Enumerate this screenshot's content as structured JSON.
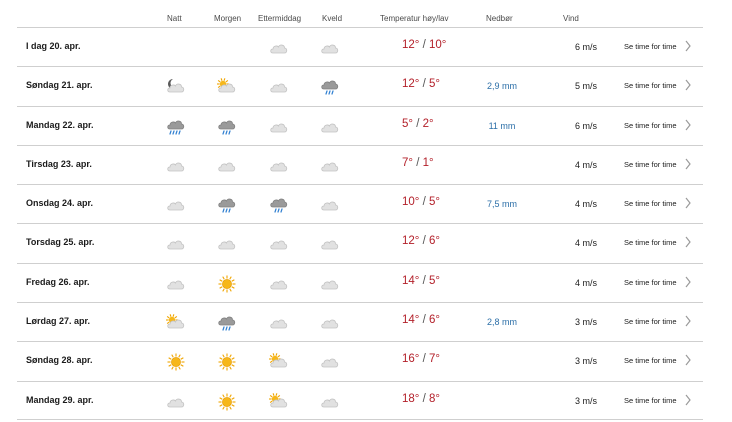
{
  "header": {
    "natt": "Natt",
    "morgen": "Morgen",
    "ettermiddag": "Ettermiddag",
    "kveld": "Kveld",
    "temperatur": "Temperatur høy/lav",
    "nedbor": "Nedbør",
    "vind": "Vind"
  },
  "link_label": "Se time for time",
  "colors": {
    "temp": "#b3202a",
    "precip": "#2c6fa8",
    "divider": "#cfcfcf"
  },
  "rows": [
    {
      "date": "I dag 20. apr.",
      "natt": "",
      "morgen": "",
      "ettermiddag": "cloud-icon",
      "kveld": "cloud-icon",
      "hi": "12°",
      "lo": "10°",
      "precip": "",
      "wind": "6 m/s"
    },
    {
      "date": "Søndag 21. apr.",
      "natt": "moon-cloud-icon",
      "morgen": "sun-cloud-icon",
      "ettermiddag": "cloud-icon",
      "kveld": "rain-cloud-icon",
      "hi": "12°",
      "lo": "5°",
      "precip": "2,9 mm",
      "wind": "5 m/s"
    },
    {
      "date": "Mandag 22. apr.",
      "natt": "heavy-rain-cloud-icon",
      "morgen": "rain-cloud-icon",
      "ettermiddag": "cloud-icon",
      "kveld": "cloud-icon",
      "hi": "5°",
      "lo": "2°",
      "precip": "11 mm",
      "wind": "6 m/s"
    },
    {
      "date": "Tirsdag 23. apr.",
      "natt": "cloud-icon",
      "morgen": "cloud-icon",
      "ettermiddag": "cloud-icon",
      "kveld": "cloud-icon",
      "hi": "7°",
      "lo": "1°",
      "precip": "",
      "wind": "4 m/s"
    },
    {
      "date": "Onsdag 24. apr.",
      "natt": "cloud-icon",
      "morgen": "rain-cloud-icon",
      "ettermiddag": "rain-cloud-icon",
      "kveld": "cloud-icon",
      "hi": "10°",
      "lo": "5°",
      "precip": "7,5 mm",
      "wind": "4 m/s"
    },
    {
      "date": "Torsdag 25. apr.",
      "natt": "cloud-icon",
      "morgen": "cloud-icon",
      "ettermiddag": "cloud-icon",
      "kveld": "cloud-icon",
      "hi": "12°",
      "lo": "6°",
      "precip": "",
      "wind": "4 m/s"
    },
    {
      "date": "Fredag 26. apr.",
      "natt": "cloud-icon",
      "morgen": "sun-icon",
      "ettermiddag": "cloud-icon",
      "kveld": "cloud-icon",
      "hi": "14°",
      "lo": "5°",
      "precip": "",
      "wind": "4 m/s"
    },
    {
      "date": "Lørdag 27. apr.",
      "natt": "sun-cloud-icon",
      "morgen": "rain-cloud-icon",
      "ettermiddag": "cloud-icon",
      "kveld": "cloud-icon",
      "hi": "14°",
      "lo": "6°",
      "precip": "2,8 mm",
      "wind": "3 m/s"
    },
    {
      "date": "Søndag 28. apr.",
      "natt": "sun-icon",
      "morgen": "sun-icon",
      "ettermiddag": "sun-cloud-icon",
      "kveld": "cloud-icon",
      "hi": "16°",
      "lo": "7°",
      "precip": "",
      "wind": "3 m/s"
    },
    {
      "date": "Mandag 29. apr.",
      "natt": "cloud-icon",
      "morgen": "sun-icon",
      "ettermiddag": "sun-cloud-icon",
      "kveld": "cloud-icon",
      "hi": "18°",
      "lo": "8°",
      "precip": "",
      "wind": "3 m/s"
    }
  ]
}
